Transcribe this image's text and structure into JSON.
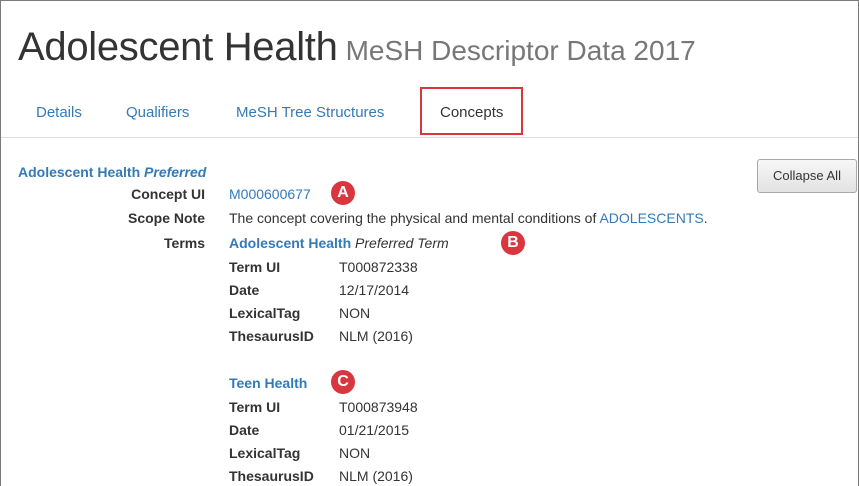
{
  "page": {
    "title": "Adolescent Health",
    "subtitle": "MeSH Descriptor Data 2017"
  },
  "tabs": [
    {
      "label": "Details"
    },
    {
      "label": "Qualifiers"
    },
    {
      "label": "MeSH Tree Structures"
    },
    {
      "label": "Concepts",
      "active": true
    }
  ],
  "concept": {
    "name": "Adolescent Health",
    "preferred_label": "Preferred",
    "collapse_label": "Collapse All",
    "concept_ui_label": "Concept UI",
    "concept_ui": "M000600677",
    "scope_note_label": "Scope Note",
    "scope_note_text": "The concept covering the physical and mental conditions of",
    "scope_note_link": "ADOLESCENTS",
    "scope_note_end": ".",
    "terms_label": "Terms"
  },
  "terms": [
    {
      "name": "Adolescent Health",
      "qualifier": "Preferred Term",
      "fields": [
        {
          "label": "Term UI",
          "value": "T000872338"
        },
        {
          "label": "Date",
          "value": "12/17/2014"
        },
        {
          "label": "LexicalTag",
          "value": "NON"
        },
        {
          "label": "ThesaurusID",
          "value": "NLM (2016)"
        }
      ]
    },
    {
      "name": "Teen Health",
      "qualifier": "",
      "fields": [
        {
          "label": "Term UI",
          "value": "T000873948"
        },
        {
          "label": "Date",
          "value": "01/21/2015"
        },
        {
          "label": "LexicalTag",
          "value": "NON"
        },
        {
          "label": "ThesaurusID",
          "value": "NLM (2016)"
        }
      ]
    }
  ],
  "callouts": [
    "A",
    "B",
    "C"
  ],
  "colors": {
    "link": "#337ab7",
    "callout": "#d9363e",
    "active_tab_border": "#d9363e"
  }
}
